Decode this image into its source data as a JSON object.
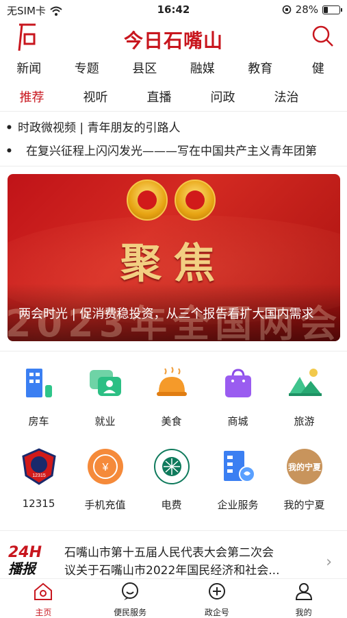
{
  "status": {
    "carrier": "无SIM卡",
    "time": "16:42",
    "battery": "28%",
    "battery_level": 0.28
  },
  "header": {
    "title": "今日石嘴山"
  },
  "nav_row1": [
    "新闻",
    "专题",
    "县区",
    "融媒",
    "教育",
    "健"
  ],
  "nav_row2": [
    "推荐",
    "视听",
    "直播",
    "问政",
    "法治"
  ],
  "headlines": [
    "时政微视频 | 青年朋友的引路人",
    "在复兴征程上闪闪发光———写在中国共产主义青年团第"
  ],
  "banner": {
    "focus_text": "聚焦",
    "background_text": "2023年全国两会",
    "caption": "两会时光 | 促消费稳投资，从三个报告看扩大国内需求"
  },
  "services_row1": [
    {
      "label": "房车",
      "icon": "building-car-icon"
    },
    {
      "label": "就业",
      "icon": "job-chat-icon"
    },
    {
      "label": "美食",
      "icon": "food-dome-icon"
    },
    {
      "label": "商城",
      "icon": "shopping-bag-icon"
    },
    {
      "label": "旅游",
      "icon": "travel-landscape-icon"
    }
  ],
  "services_row2": [
    {
      "label": "12315",
      "icon": "consumer-badge-icon",
      "badge_text": "12315"
    },
    {
      "label": "手机充值",
      "icon": "phone-recharge-icon"
    },
    {
      "label": "电费",
      "icon": "state-grid-icon"
    },
    {
      "label": "企业服务",
      "icon": "enterprise-service-icon"
    },
    {
      "label": "我的宁夏",
      "icon": "my-ningxia-icon",
      "badge_text": "我的宁夏"
    }
  ],
  "news24": {
    "badge_top": "24H",
    "badge_bottom": "播报",
    "line1": "石嘴山市第十五届人民代表大会第二次会",
    "line2": "议关于石嘴山市2022年国民经济和社会..."
  },
  "tabbar": [
    {
      "label": "主页",
      "icon": "home-icon"
    },
    {
      "label": "便民服务",
      "icon": "smile-service-icon"
    },
    {
      "label": "政企号",
      "icon": "plus-circle-icon"
    },
    {
      "label": "我的",
      "icon": "person-icon"
    }
  ],
  "colors": {
    "brand": "#c8161e",
    "text": "#222222"
  }
}
